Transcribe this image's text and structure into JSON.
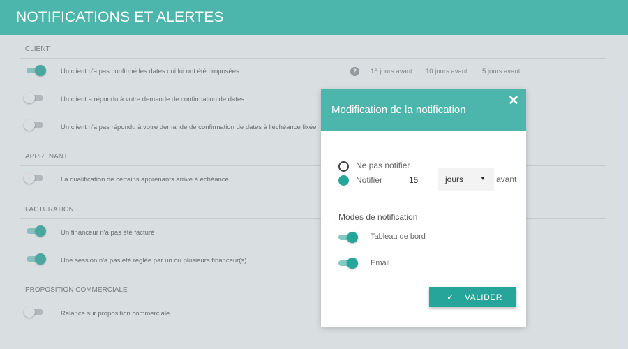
{
  "header": {
    "title": "NOTIFICATIONS ET ALERTES"
  },
  "sections": [
    {
      "title": "CLIENT",
      "rows": [
        {
          "text": "Un client n'a pas confirmé les dates qui lui ont été proposées",
          "enabled": true
        },
        {
          "text": "Un client a répondu à votre demande de confirmation de dates",
          "enabled": false
        },
        {
          "text": "Un client n'a pas répondu à votre demande de confirmation de dates à l'échéance fixée",
          "enabled": false
        }
      ]
    },
    {
      "title": "APPRENANT",
      "rows": [
        {
          "text": "La qualification de certains apprenants arrive à échéance",
          "enabled": false
        }
      ]
    },
    {
      "title": "FACTURATION",
      "rows": [
        {
          "text": "Un financeur n'a pas été facturé",
          "enabled": true
        },
        {
          "text": "Une session n'a pas été reglée par un ou plusieurs financeur(s)",
          "enabled": true
        }
      ]
    },
    {
      "title": "PROPOSITION COMMERCIALE",
      "rows": [
        {
          "text": "Relance sur proposition commerciale",
          "enabled": false
        }
      ]
    }
  ],
  "row_options": {
    "help_icon": "?",
    "values": [
      "15 jours avant",
      "10 jours avant",
      "5 jours avant"
    ]
  },
  "modal": {
    "title": "Modification de la notification",
    "close_icon": "✕",
    "options": {
      "no_notify": "Ne pas notifier",
      "notify": "Notifier",
      "selected": "notify"
    },
    "days_value": "15",
    "unit_value": "jours",
    "suffix": "avant",
    "modes_title": "Modes de notification",
    "modes": [
      {
        "label": "Tableau de bord",
        "enabled": true
      },
      {
        "label": "Email",
        "enabled": true
      }
    ],
    "validate_label": "VALIDER"
  },
  "colors": {
    "accent": "#4db6ac",
    "accent_dark": "#26a69a"
  }
}
